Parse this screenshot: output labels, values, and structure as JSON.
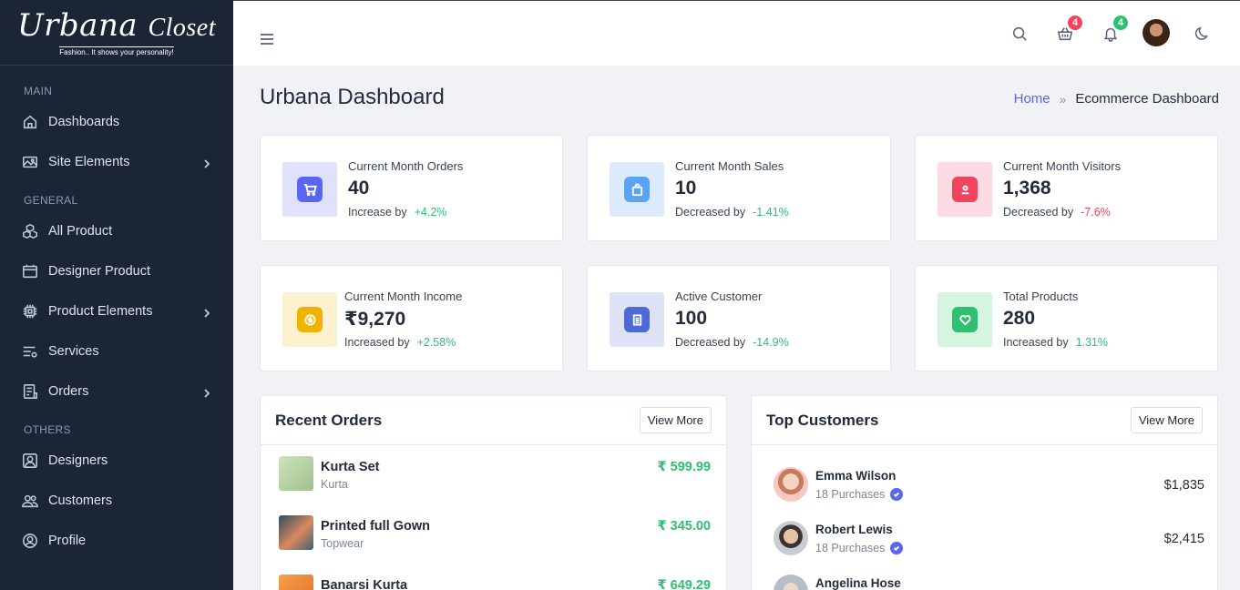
{
  "brand": {
    "name": "Urbana",
    "name_script": "Closet",
    "tagline": "Fashion.. It shows your personality!"
  },
  "sidebar": {
    "sections": [
      {
        "label": "MAIN"
      },
      {
        "label": "GENERAL"
      },
      {
        "label": "OTHERS"
      }
    ],
    "items": [
      {
        "label": "Dashboards",
        "icon": "home-icon"
      },
      {
        "label": "Site Elements",
        "icon": "image-icon",
        "has_submenu": true
      },
      {
        "label": "All Product",
        "icon": "cubes-icon"
      },
      {
        "label": "Designer Product",
        "icon": "store-icon"
      },
      {
        "label": "Product Elements",
        "icon": "chip-icon",
        "has_submenu": true
      },
      {
        "label": "Services",
        "icon": "services-icon"
      },
      {
        "label": "Orders",
        "icon": "orders-icon",
        "has_submenu": true
      },
      {
        "label": "Designers",
        "icon": "designer-icon"
      },
      {
        "label": "Customers",
        "icon": "users-icon"
      },
      {
        "label": "Profile",
        "icon": "profile-icon"
      }
    ]
  },
  "header": {
    "cart_count": "4",
    "notification_count": "4",
    "colors": {
      "cart_badge": "#f0455d",
      "notif_badge": "#2fbf71"
    }
  },
  "page": {
    "title": "Urbana Dashboard",
    "breadcrumb": {
      "home": "Home",
      "separator": "»",
      "current": "Ecommerce Dashboard"
    }
  },
  "stats": [
    {
      "title": "Current Month Orders",
      "value": "40",
      "change_label": "Increase by",
      "change": "+4.2%",
      "change_color": "#2fbf71",
      "icon": "cart-icon",
      "bg": "#e0e2fb",
      "fg": "#5a66f1"
    },
    {
      "title": "Current Month Sales",
      "value": "10",
      "change_label": "Decreased by",
      "change": "-1.41%",
      "change_color": "#2fbf71",
      "icon": "bag-icon",
      "bg": "#dbeafd",
      "fg": "#5aa4f5"
    },
    {
      "title": "Current Month Visitors",
      "value": "1,368",
      "change_label": "Decreased by",
      "change": "-7.6%",
      "change_color": "#f0455d",
      "icon": "visitor-icon",
      "bg": "#fcdbe2",
      "fg": "#f0455d"
    },
    {
      "title": "Current Month Income",
      "value": "₹9,270",
      "change_label": "Increased by",
      "change": "+2.58%",
      "change_color": "#2fbf71",
      "icon": "coin-icon",
      "bg": "#fdf0cc",
      "fg": "#f0b400"
    },
    {
      "title": "Active Customer",
      "value": "100",
      "change_label": "Decreased by",
      "change": "-14.9%",
      "change_color": "#2fbf71",
      "icon": "receipt-icon",
      "bg": "#dde2f5",
      "fg": "#4e6ad6"
    },
    {
      "title": "Total Products",
      "value": "280",
      "change_label": "Increased by",
      "change": "1.31%",
      "change_color": "#2fbf71",
      "icon": "heart-icon",
      "bg": "#d5f5e1",
      "fg": "#2fbf71"
    }
  ],
  "recent_orders": {
    "title": "Recent Orders",
    "button": "View More",
    "items": [
      {
        "name": "Kurta Set",
        "category": "Kurta",
        "price": "₹ 599.99",
        "thumb_color": "#b9d4a7"
      },
      {
        "name": "Printed full Gown",
        "category": "Topwear",
        "price": "₹ 345.00",
        "thumb_color": "#3d6275"
      },
      {
        "name": "Banarsi Kurta",
        "category": "",
        "price": "₹ 649.29",
        "thumb_color": "#f08a3a"
      }
    ]
  },
  "top_customers": {
    "title": "Top Customers",
    "button": "View More",
    "items": [
      {
        "name": "Emma Wilson",
        "purchases": "18 Purchases",
        "amount": "$1,835",
        "avatar_color": "#f5c9c0"
      },
      {
        "name": "Robert Lewis",
        "purchases": "18 Purchases",
        "amount": "$2,415",
        "avatar_color": "#c9ccd3"
      },
      {
        "name": "Angelina Hose",
        "purchases": "",
        "amount": "",
        "avatar_color": "#d8dde6"
      }
    ]
  }
}
